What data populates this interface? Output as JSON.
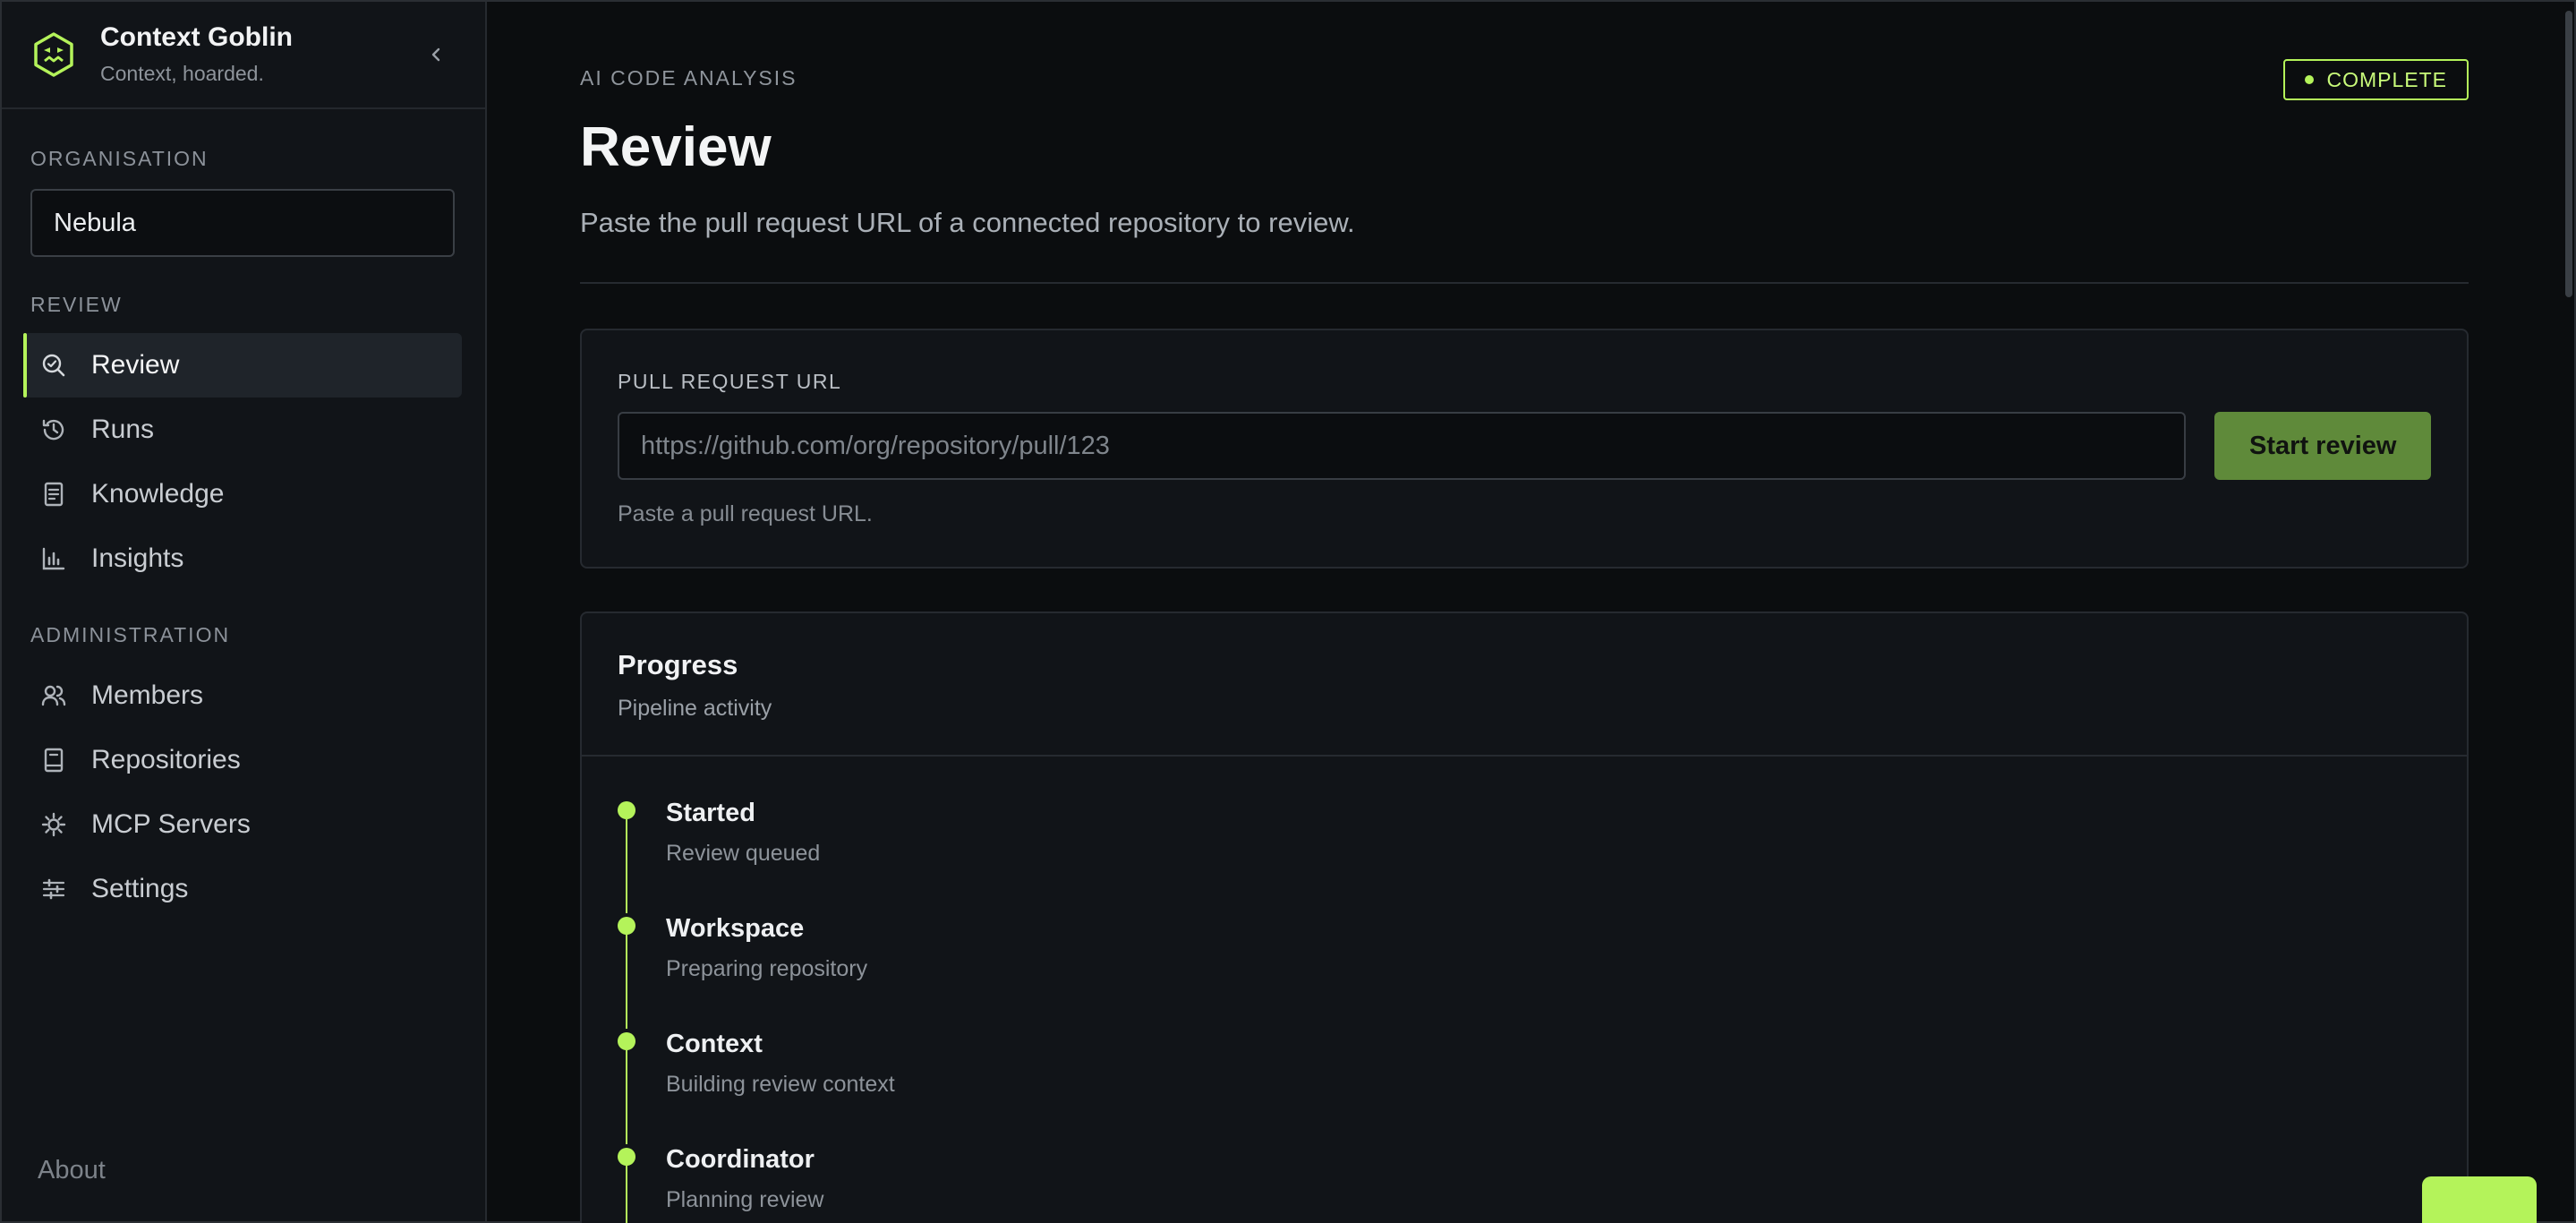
{
  "brand": {
    "title": "Context Goblin",
    "subtitle": "Context, hoarded."
  },
  "sidebar": {
    "org_label": "ORGANISATION",
    "org_value": "Nebula",
    "review_label": "REVIEW",
    "review_items": [
      {
        "label": "Review",
        "icon": "review-search-icon",
        "active": true
      },
      {
        "label": "Runs",
        "icon": "history-icon"
      },
      {
        "label": "Knowledge",
        "icon": "document-icon"
      },
      {
        "label": "Insights",
        "icon": "bar-chart-icon"
      }
    ],
    "admin_label": "ADMINISTRATION",
    "admin_items": [
      {
        "label": "Members",
        "icon": "users-icon"
      },
      {
        "label": "Repositories",
        "icon": "book-icon"
      },
      {
        "label": "MCP Servers",
        "icon": "server-gear-icon"
      },
      {
        "label": "Settings",
        "icon": "sliders-icon"
      }
    ],
    "about_label": "About"
  },
  "main": {
    "eyebrow": "AI CODE ANALYSIS",
    "status": "COMPLETE",
    "title": "Review",
    "description": "Paste the pull request URL of a connected repository to review.",
    "url_form": {
      "label": "PULL REQUEST URL",
      "placeholder": "https://github.com/org/repository/pull/123",
      "value": "",
      "button": "Start review",
      "helper": "Paste a pull request URL."
    },
    "progress": {
      "title": "Progress",
      "subtitle": "Pipeline activity",
      "steps": [
        {
          "title": "Started",
          "desc": "Review queued"
        },
        {
          "title": "Workspace",
          "desc": "Preparing repository"
        },
        {
          "title": "Context",
          "desc": "Building review context"
        },
        {
          "title": "Coordinator",
          "desc": "Planning review"
        }
      ]
    }
  },
  "colors": {
    "accent": "#b4f35a",
    "button": "#5f8a3a",
    "background": "#0b0d0f",
    "sidebar": "#111418"
  }
}
